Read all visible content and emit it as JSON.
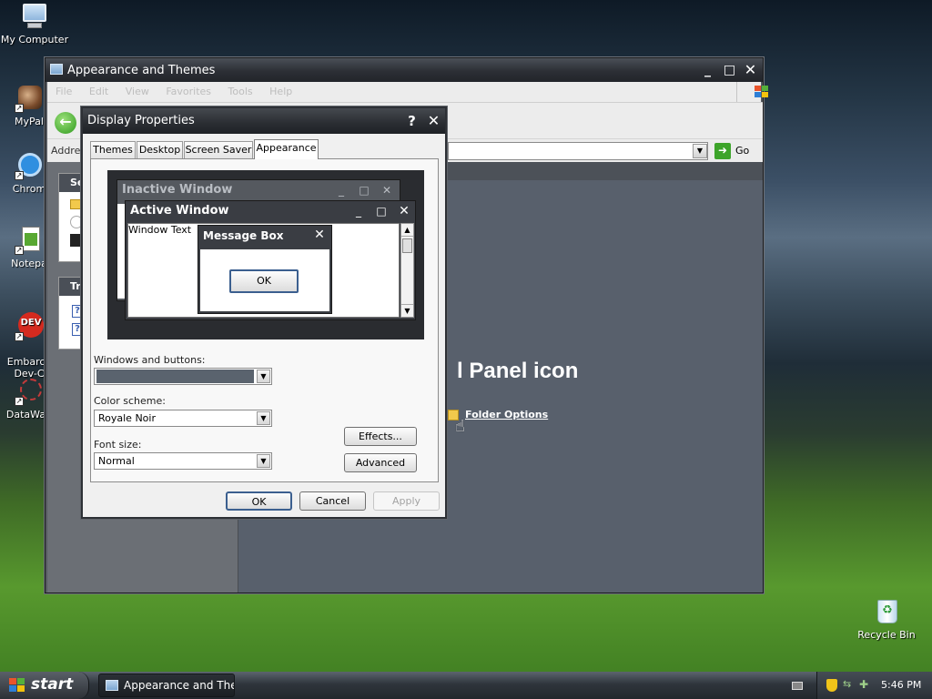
{
  "desktop": {
    "icons": [
      {
        "label": "My Computer"
      },
      {
        "label": "MyPal"
      },
      {
        "label": "Chrom"
      },
      {
        "label": "Notepa"
      },
      {
        "label": "Embarca\nDev-C"
      },
      {
        "label": "DataWag"
      }
    ],
    "recycle_bin": "Recycle Bin"
  },
  "back_window": {
    "title": "Appearance and Themes",
    "menu": [
      "File",
      "Edit",
      "View",
      "Favorites",
      "Tools",
      "Help"
    ],
    "address_label": "Addres",
    "go_label": "Go",
    "side_sections": [
      "Se",
      "Tr"
    ],
    "heading_fragment": "l Panel icon",
    "link": "Folder Options"
  },
  "dialog": {
    "title": "Display Properties",
    "tabs": [
      "Themes",
      "Desktop",
      "Screen Saver",
      "Appearance"
    ],
    "active_tab": "Appearance",
    "preview": {
      "inactive_title": "Inactive Window",
      "active_title": "Active Window",
      "window_text": "Window Text",
      "msgbox_title": "Message Box",
      "msgbox_ok": "OK"
    },
    "windows_buttons_label": "Windows and buttons:",
    "windows_buttons_value": "",
    "color_scheme_label": "Color scheme:",
    "color_scheme_value": "Royale Noir",
    "font_size_label": "Font size:",
    "font_size_value": "Normal",
    "effects_btn": "Effects...",
    "advanced_btn": "Advanced",
    "ok_btn": "OK",
    "cancel_btn": "Cancel",
    "apply_btn": "Apply",
    "help_glyph": "?"
  },
  "taskbar": {
    "start_label": "start",
    "task_label": "Appearance and The...",
    "clock": "5:46 PM"
  },
  "colors": {
    "dark_chrome": "#2c2f35",
    "dialog_face": "#f0f0f0",
    "default_button_border": "#3b5f8f"
  }
}
